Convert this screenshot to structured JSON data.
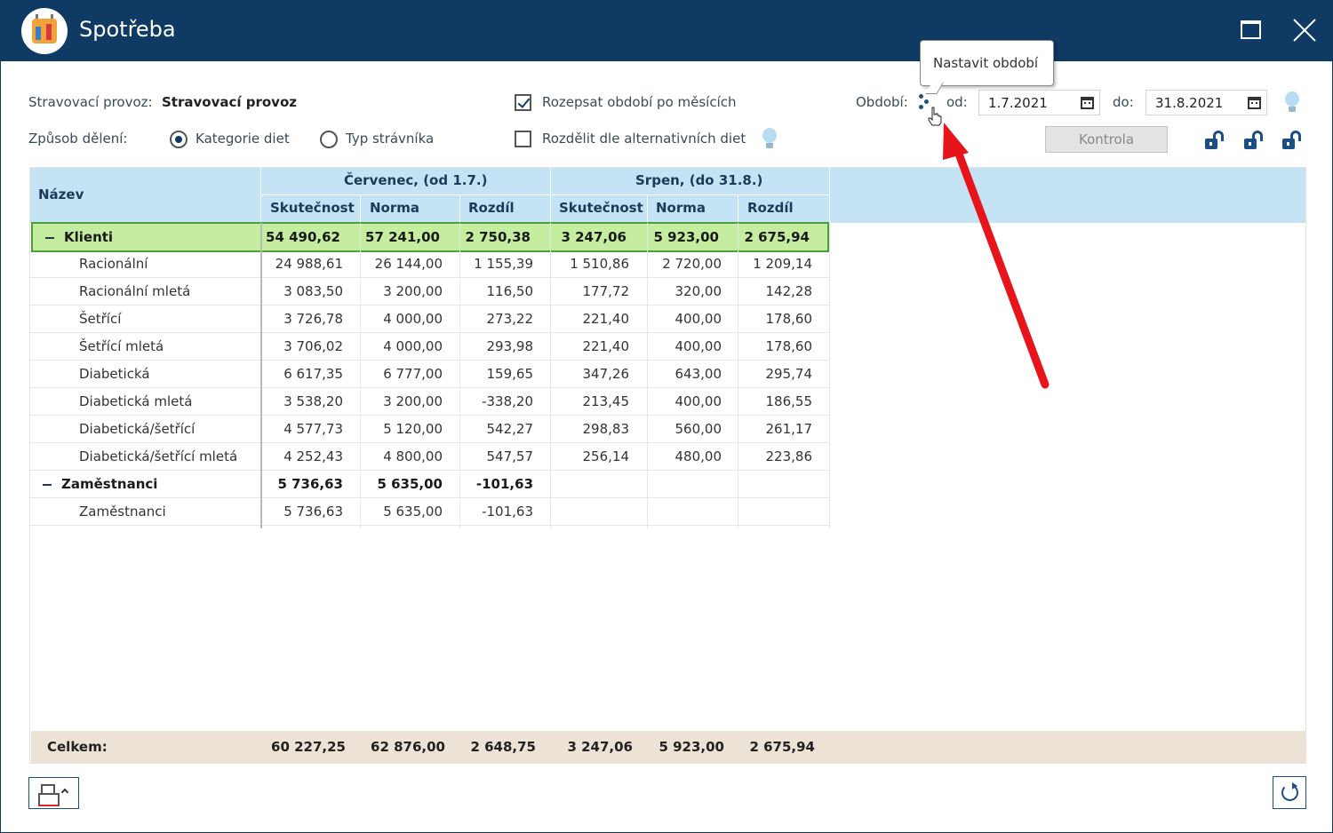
{
  "window": {
    "title": "Spotřeba"
  },
  "filters": {
    "provoz_label": "Stravovací provoz:",
    "provoz_value": "Stravovací provoz",
    "split_label": "Způsob dělení:",
    "split_options": [
      {
        "label": "Kategorie diet",
        "selected": true
      },
      {
        "label": "Typ strávníka",
        "selected": false
      }
    ],
    "checkbox_months": {
      "label": "Rozepsat období po měsících",
      "checked": true
    },
    "checkbox_alt_diets": {
      "label": "Rozdělit dle alternativních diet",
      "checked": false
    },
    "period_label": "Období:",
    "from_label": "od:",
    "from_value": "1.7.2021",
    "to_label": "do:",
    "to_value": "31.8.2021",
    "kontrola_label": "Kontrola",
    "tooltip": "Nastavit období"
  },
  "table": {
    "name_header": "Název",
    "periods": [
      {
        "title": "Červenec, (od 1.7.)",
        "columns": [
          "Skutečnost",
          "Norma",
          "Rozdíl"
        ]
      },
      {
        "title": "Srpen, (do 31.8.)",
        "columns": [
          "Skutečnost",
          "Norma",
          "Rozdíl"
        ]
      }
    ],
    "rows": [
      {
        "name": "Klienti",
        "group": true,
        "values": [
          "54 490,62",
          "57 241,00",
          "2 750,38",
          "3 247,06",
          "5 923,00",
          "2 675,94"
        ]
      },
      {
        "name": "Racionální",
        "group": false,
        "values": [
          "24 988,61",
          "26 144,00",
          "1 155,39",
          "1 510,86",
          "2 720,00",
          "1 209,14"
        ]
      },
      {
        "name": "Racionální mletá",
        "group": false,
        "values": [
          "3 083,50",
          "3 200,00",
          "116,50",
          "177,72",
          "320,00",
          "142,28"
        ]
      },
      {
        "name": "Šetřící",
        "group": false,
        "values": [
          "3 726,78",
          "4 000,00",
          "273,22",
          "221,40",
          "400,00",
          "178,60"
        ]
      },
      {
        "name": "Šetřící mletá",
        "group": false,
        "values": [
          "3 706,02",
          "4 000,00",
          "293,98",
          "221,40",
          "400,00",
          "178,60"
        ]
      },
      {
        "name": "Diabetická",
        "group": false,
        "values": [
          "6 617,35",
          "6 777,00",
          "159,65",
          "347,26",
          "643,00",
          "295,74"
        ]
      },
      {
        "name": "Diabetická mletá",
        "group": false,
        "values": [
          "3 538,20",
          "3 200,00",
          "-338,20",
          "213,45",
          "400,00",
          "186,55"
        ]
      },
      {
        "name": "Diabetická/šetřící",
        "group": false,
        "values": [
          "4 577,73",
          "5 120,00",
          "542,27",
          "298,83",
          "560,00",
          "261,17"
        ]
      },
      {
        "name": "Diabetická/šetřící mletá",
        "group": false,
        "values": [
          "4 252,43",
          "4 800,00",
          "547,57",
          "256,14",
          "480,00",
          "223,86"
        ]
      },
      {
        "name": "Zaměstnanci",
        "group": true,
        "values": [
          "5 736,63",
          "5 635,00",
          "-101,63",
          "",
          "",
          ""
        ]
      },
      {
        "name": "Zaměstnanci",
        "group": false,
        "values": [
          "5 736,63",
          "5 635,00",
          "-101,63",
          "",
          "",
          ""
        ]
      }
    ],
    "total": {
      "label": "Celkem:",
      "values": [
        "60 227,25",
        "62 876,00",
        "2 648,75",
        "3 247,06",
        "5 923,00",
        "2 675,94"
      ]
    }
  },
  "colors": {
    "titlebar": "#0e3a63",
    "header_band": "#c4e3f5",
    "selected_row": "#c4eda0",
    "selected_border": "#4aa03a",
    "total_band": "#ece2d6",
    "annotation_arrow": "#e8141c"
  },
  "icons": [
    "app-calendar-icon",
    "maximize-icon",
    "close-icon",
    "lightbulb-icon",
    "calendar-icon",
    "period-dots-icon",
    "unlock-icon",
    "printer-icon",
    "refresh-icon",
    "hand-cursor-icon"
  ]
}
